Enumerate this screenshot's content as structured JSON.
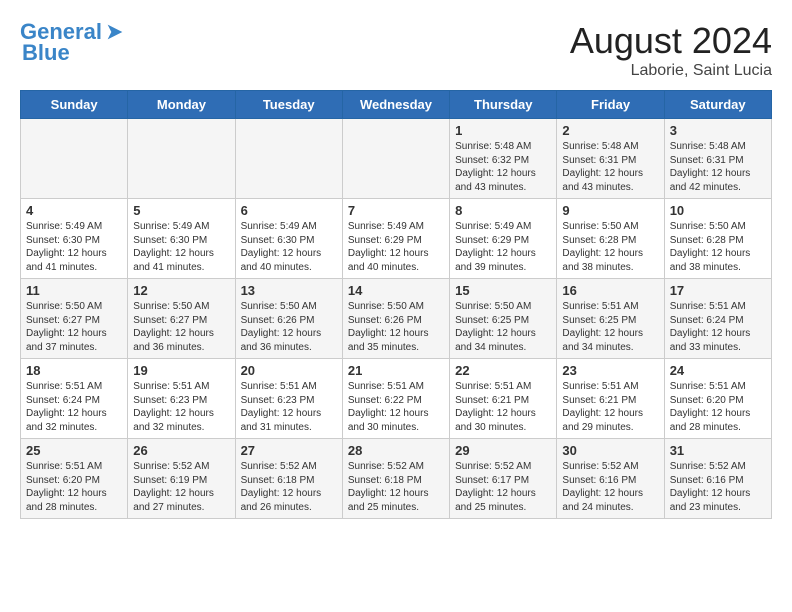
{
  "header": {
    "logo_line1": "General",
    "logo_line2": "Blue",
    "month_year": "August 2024",
    "location": "Laborie, Saint Lucia"
  },
  "days_of_week": [
    "Sunday",
    "Monday",
    "Tuesday",
    "Wednesday",
    "Thursday",
    "Friday",
    "Saturday"
  ],
  "weeks": [
    [
      {
        "day": "",
        "info": ""
      },
      {
        "day": "",
        "info": ""
      },
      {
        "day": "",
        "info": ""
      },
      {
        "day": "",
        "info": ""
      },
      {
        "day": "1",
        "info": "Sunrise: 5:48 AM\nSunset: 6:32 PM\nDaylight: 12 hours\nand 43 minutes."
      },
      {
        "day": "2",
        "info": "Sunrise: 5:48 AM\nSunset: 6:31 PM\nDaylight: 12 hours\nand 43 minutes."
      },
      {
        "day": "3",
        "info": "Sunrise: 5:48 AM\nSunset: 6:31 PM\nDaylight: 12 hours\nand 42 minutes."
      }
    ],
    [
      {
        "day": "4",
        "info": "Sunrise: 5:49 AM\nSunset: 6:30 PM\nDaylight: 12 hours\nand 41 minutes."
      },
      {
        "day": "5",
        "info": "Sunrise: 5:49 AM\nSunset: 6:30 PM\nDaylight: 12 hours\nand 41 minutes."
      },
      {
        "day": "6",
        "info": "Sunrise: 5:49 AM\nSunset: 6:30 PM\nDaylight: 12 hours\nand 40 minutes."
      },
      {
        "day": "7",
        "info": "Sunrise: 5:49 AM\nSunset: 6:29 PM\nDaylight: 12 hours\nand 40 minutes."
      },
      {
        "day": "8",
        "info": "Sunrise: 5:49 AM\nSunset: 6:29 PM\nDaylight: 12 hours\nand 39 minutes."
      },
      {
        "day": "9",
        "info": "Sunrise: 5:50 AM\nSunset: 6:28 PM\nDaylight: 12 hours\nand 38 minutes."
      },
      {
        "day": "10",
        "info": "Sunrise: 5:50 AM\nSunset: 6:28 PM\nDaylight: 12 hours\nand 38 minutes."
      }
    ],
    [
      {
        "day": "11",
        "info": "Sunrise: 5:50 AM\nSunset: 6:27 PM\nDaylight: 12 hours\nand 37 minutes."
      },
      {
        "day": "12",
        "info": "Sunrise: 5:50 AM\nSunset: 6:27 PM\nDaylight: 12 hours\nand 36 minutes."
      },
      {
        "day": "13",
        "info": "Sunrise: 5:50 AM\nSunset: 6:26 PM\nDaylight: 12 hours\nand 36 minutes."
      },
      {
        "day": "14",
        "info": "Sunrise: 5:50 AM\nSunset: 6:26 PM\nDaylight: 12 hours\nand 35 minutes."
      },
      {
        "day": "15",
        "info": "Sunrise: 5:50 AM\nSunset: 6:25 PM\nDaylight: 12 hours\nand 34 minutes."
      },
      {
        "day": "16",
        "info": "Sunrise: 5:51 AM\nSunset: 6:25 PM\nDaylight: 12 hours\nand 34 minutes."
      },
      {
        "day": "17",
        "info": "Sunrise: 5:51 AM\nSunset: 6:24 PM\nDaylight: 12 hours\nand 33 minutes."
      }
    ],
    [
      {
        "day": "18",
        "info": "Sunrise: 5:51 AM\nSunset: 6:24 PM\nDaylight: 12 hours\nand 32 minutes."
      },
      {
        "day": "19",
        "info": "Sunrise: 5:51 AM\nSunset: 6:23 PM\nDaylight: 12 hours\nand 32 minutes."
      },
      {
        "day": "20",
        "info": "Sunrise: 5:51 AM\nSunset: 6:23 PM\nDaylight: 12 hours\nand 31 minutes."
      },
      {
        "day": "21",
        "info": "Sunrise: 5:51 AM\nSunset: 6:22 PM\nDaylight: 12 hours\nand 30 minutes."
      },
      {
        "day": "22",
        "info": "Sunrise: 5:51 AM\nSunset: 6:21 PM\nDaylight: 12 hours\nand 30 minutes."
      },
      {
        "day": "23",
        "info": "Sunrise: 5:51 AM\nSunset: 6:21 PM\nDaylight: 12 hours\nand 29 minutes."
      },
      {
        "day": "24",
        "info": "Sunrise: 5:51 AM\nSunset: 6:20 PM\nDaylight: 12 hours\nand 28 minutes."
      }
    ],
    [
      {
        "day": "25",
        "info": "Sunrise: 5:51 AM\nSunset: 6:20 PM\nDaylight: 12 hours\nand 28 minutes."
      },
      {
        "day": "26",
        "info": "Sunrise: 5:52 AM\nSunset: 6:19 PM\nDaylight: 12 hours\nand 27 minutes."
      },
      {
        "day": "27",
        "info": "Sunrise: 5:52 AM\nSunset: 6:18 PM\nDaylight: 12 hours\nand 26 minutes."
      },
      {
        "day": "28",
        "info": "Sunrise: 5:52 AM\nSunset: 6:18 PM\nDaylight: 12 hours\nand 25 minutes."
      },
      {
        "day": "29",
        "info": "Sunrise: 5:52 AM\nSunset: 6:17 PM\nDaylight: 12 hours\nand 25 minutes."
      },
      {
        "day": "30",
        "info": "Sunrise: 5:52 AM\nSunset: 6:16 PM\nDaylight: 12 hours\nand 24 minutes."
      },
      {
        "day": "31",
        "info": "Sunrise: 5:52 AM\nSunset: 6:16 PM\nDaylight: 12 hours\nand 23 minutes."
      }
    ]
  ]
}
